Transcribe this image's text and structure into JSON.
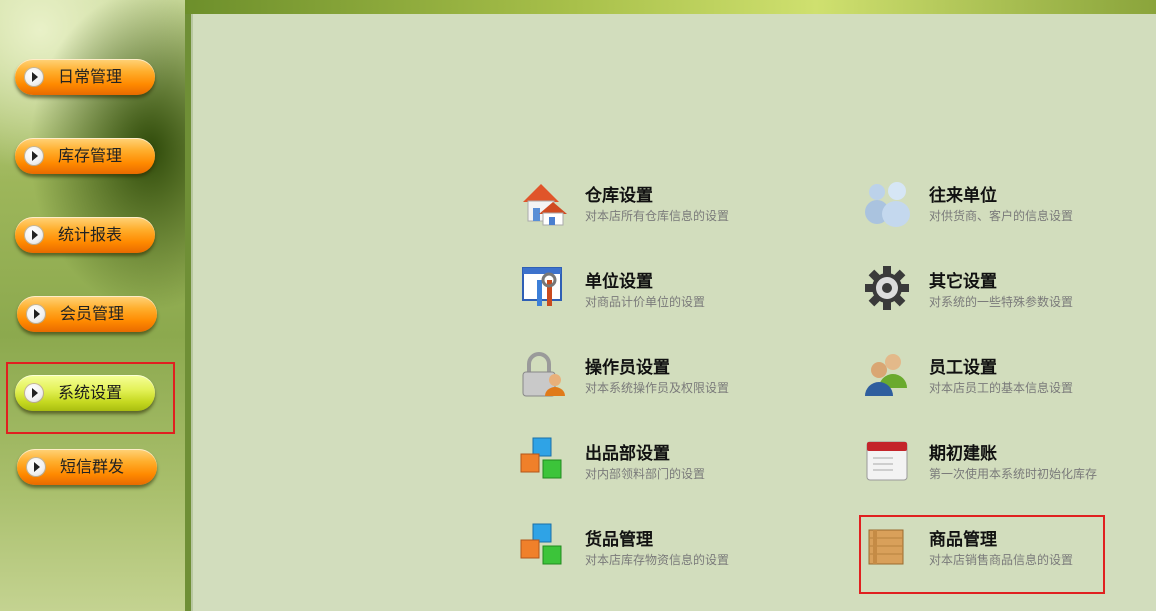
{
  "sidebar": {
    "items": [
      {
        "label": "日常管理",
        "icon": "play-icon"
      },
      {
        "label": "库存管理",
        "icon": "play-icon"
      },
      {
        "label": "统计报表",
        "icon": "play-icon"
      },
      {
        "label": "会员管理",
        "icon": "play-icon"
      },
      {
        "label": "系统设置",
        "icon": "play-icon",
        "active": true
      },
      {
        "label": "短信群发",
        "icon": "play-icon"
      }
    ]
  },
  "main": {
    "items": [
      {
        "title": "仓库设置",
        "desc": "对本店所有仓库信息的设置",
        "icon": "warehouse-house-icon"
      },
      {
        "title": "往来单位",
        "desc": "对供货商、客户的信息设置",
        "icon": "contacts-people-icon"
      },
      {
        "title": "单位设置",
        "desc": "对商品计价单位的设置",
        "icon": "tools-window-icon"
      },
      {
        "title": "其它设置",
        "desc": "对系统的一些特殊参数设置",
        "icon": "gear-icon"
      },
      {
        "title": "操作员设置",
        "desc": "对本系统操作员及权限设置",
        "icon": "lock-user-icon"
      },
      {
        "title": "员工设置",
        "desc": "对本店员工的基本信息设置",
        "icon": "employees-icon"
      },
      {
        "title": "出品部设置",
        "desc": "对内部领料部门的设置",
        "icon": "colored-cubes-icon"
      },
      {
        "title": "期初建账",
        "desc": "第一次使用本系统时初始化库存",
        "icon": "calendar-icon"
      },
      {
        "title": "货品管理",
        "desc": "对本店库存物资信息的设置",
        "icon": "colored-cubes-icon"
      },
      {
        "title": "商品管理",
        "desc": "对本店销售商品信息的设置",
        "icon": "wooden-crate-icon"
      }
    ]
  },
  "colors": {
    "nav_orange": "#ff9a1a",
    "nav_active": "#d7e63a",
    "panel_bg": "#d2ddbd",
    "highlight_red": "#e02020"
  }
}
